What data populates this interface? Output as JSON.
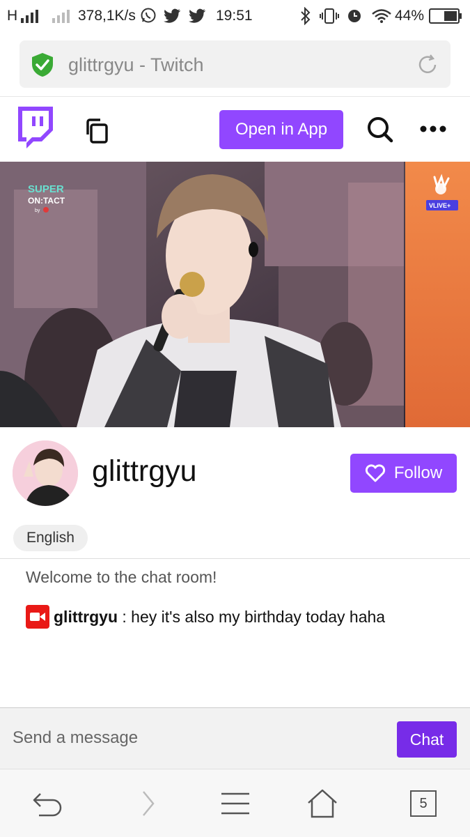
{
  "status_bar": {
    "network": "H",
    "speed": "378,1K/s",
    "time": "19:51",
    "battery": "44%"
  },
  "browser": {
    "url_text": "glittrgyu - Twitch",
    "tabs_count": "5"
  },
  "header": {
    "open_app_label": "Open in App"
  },
  "video": {
    "overlay_left_line1": "SUPER",
    "overlay_left_line2": "ON:TACT",
    "overlay_left_by": "by",
    "overlay_right_label": "VLIVE+"
  },
  "channel": {
    "name": "glittrgyu",
    "follow_label": "Follow",
    "language": "English"
  },
  "chat": {
    "welcome": "Welcome to the chat room!",
    "messages": [
      {
        "user": "glittrgyu",
        "separator": " : ",
        "text": "hey it's also my birthday today haha"
      }
    ],
    "input_placeholder": "Send a message",
    "send_label": "Chat"
  },
  "colors": {
    "twitch_purple": "#9147ff",
    "chat_button": "#772ce8",
    "secure_shield": "#3aaa35",
    "broadcaster_badge": "#e91916"
  }
}
